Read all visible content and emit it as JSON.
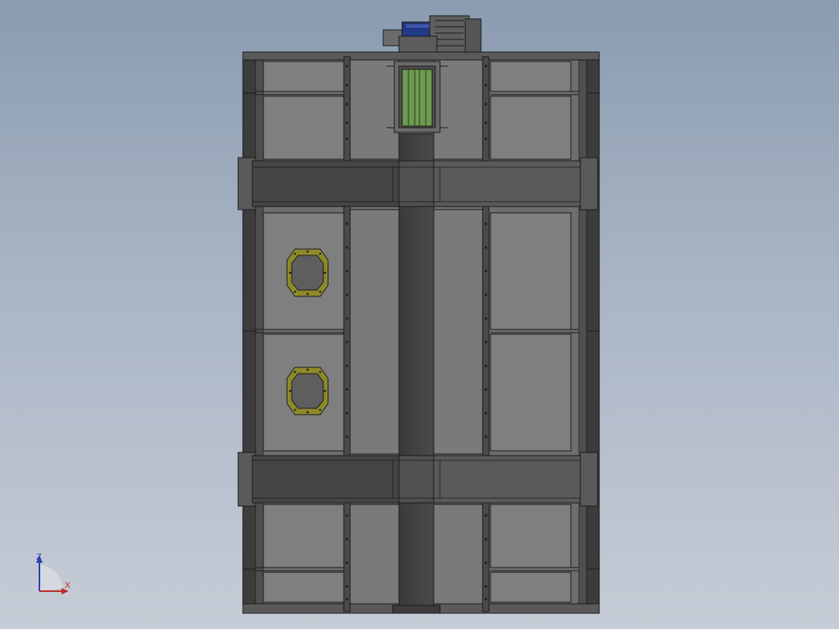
{
  "viewport": {
    "view_orientation": "front",
    "model_colors": {
      "frame_dark": "#3c3c3c",
      "frame_mid": "#5a5a5a",
      "panel_light": "#7f7f7f",
      "panel_mid": "#6e6e6e",
      "beam_dark": "#454545",
      "edge": "#1a1a1a",
      "flange_olive": "#8e8a2a",
      "filter_green": "#6f9a52",
      "motor_blue": "#223a8a"
    },
    "coordinate_triad": {
      "vertical_axis_label": "Z",
      "horizontal_axis_label": "X",
      "vertical_axis_color": "#2b3fb0",
      "horizontal_axis_color": "#c0282a"
    }
  }
}
